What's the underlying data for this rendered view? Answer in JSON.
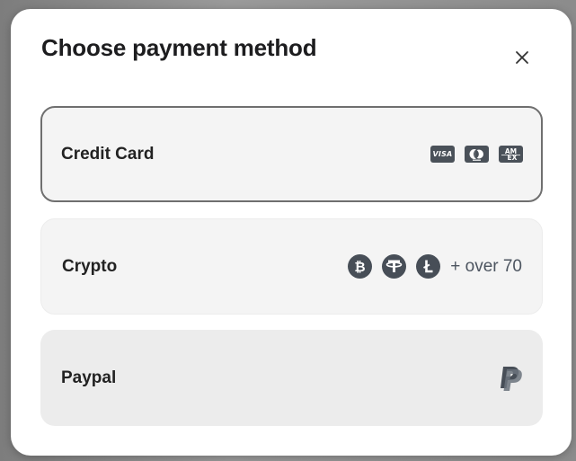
{
  "modal": {
    "title": "Choose payment method"
  },
  "options": [
    {
      "label": "Credit Card",
      "icons": [
        "visa-icon",
        "mastercard-icon",
        "amex-icon"
      ],
      "selected": true
    },
    {
      "label": "Crypto",
      "icons": [
        "bitcoin-icon",
        "tether-icon",
        "litecoin-icon"
      ],
      "extra": "+ over 70"
    },
    {
      "label": "Paypal",
      "icons": [
        "paypal-icon"
      ]
    }
  ],
  "card_logos": {
    "visa": "VISA",
    "amex": "AM EX"
  },
  "colors": {
    "selected_border": "#6f6f6f",
    "icon_fill": "#474e57",
    "option_bg": "#f4f4f4"
  }
}
